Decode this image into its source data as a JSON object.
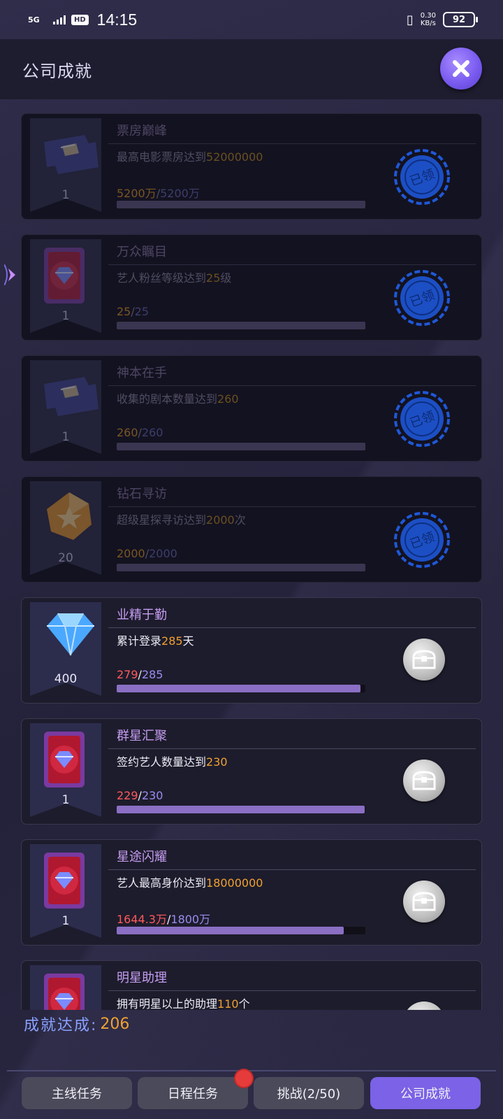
{
  "status_bar": {
    "network": "5G",
    "hd": "HD",
    "time": "14:15",
    "speed_value": "0.30",
    "speed_unit": "KB/s",
    "battery": "92"
  },
  "header": {
    "title": "公司成就"
  },
  "achievements": [
    {
      "title": "票房巅峰",
      "desc_prefix": "最高电影票房达到",
      "desc_value": "52000000",
      "desc_suffix": "",
      "progress_current": "5200万",
      "progress_target": "5200万",
      "progress_fraction": 1.0,
      "reward_count": "1",
      "reward_icon": "ticket-icon",
      "status": "claimed",
      "stamp_text": "已领"
    },
    {
      "title": "万众瞩目",
      "desc_prefix": "艺人粉丝等级达到",
      "desc_value": "25",
      "desc_suffix": "级",
      "progress_current": "25",
      "progress_target": "25",
      "progress_fraction": 1.0,
      "reward_count": "1",
      "reward_icon": "diamond-card-icon",
      "status": "claimed",
      "stamp_text": "已领"
    },
    {
      "title": "神本在手",
      "desc_prefix": "收集的剧本数量达到",
      "desc_value": "260",
      "desc_suffix": "",
      "progress_current": "260",
      "progress_target": "260",
      "progress_fraction": 1.0,
      "reward_count": "1",
      "reward_icon": "ticket-icon",
      "status": "claimed",
      "stamp_text": "已领"
    },
    {
      "title": "钻石寻访",
      "desc_prefix": "超级星探寻访达到",
      "desc_value": "2000",
      "desc_suffix": "次",
      "progress_current": "2000",
      "progress_target": "2000",
      "progress_fraction": 1.0,
      "reward_count": "20",
      "reward_icon": "star-gem-icon",
      "status": "claimed",
      "stamp_text": "已领"
    },
    {
      "title": "业精于勤",
      "desc_prefix": "累计登录",
      "desc_value": "285",
      "desc_suffix": "天",
      "progress_current": "279",
      "progress_target": "285",
      "progress_fraction": 0.979,
      "reward_count": "400",
      "reward_icon": "diamond-icon",
      "status": "in_progress"
    },
    {
      "title": "群星汇聚",
      "desc_prefix": "签约艺人数量达到",
      "desc_value": "230",
      "desc_suffix": "",
      "progress_current": "229",
      "progress_target": "230",
      "progress_fraction": 0.996,
      "reward_count": "1",
      "reward_icon": "diamond-card-icon",
      "status": "in_progress"
    },
    {
      "title": "星途闪耀",
      "desc_prefix": "艺人最高身价达到",
      "desc_value": "18000000",
      "desc_suffix": "",
      "progress_current": "1644.3万",
      "progress_target": "1800万",
      "progress_fraction": 0.914,
      "reward_count": "1",
      "reward_icon": "diamond-card-icon",
      "status": "in_progress"
    },
    {
      "title": "明星助理",
      "desc_prefix": "拥有明星以上的助理",
      "desc_value": "110",
      "desc_suffix": "个",
      "progress_current": "",
      "progress_target": "",
      "progress_fraction": 0.9,
      "reward_count": "",
      "reward_icon": "diamond-card-icon",
      "status": "in_progress"
    }
  ],
  "summary": {
    "label": "成就达成:",
    "value": "206"
  },
  "tabs": [
    {
      "label": "主线任务",
      "active": false,
      "badge": false
    },
    {
      "label": "日程任务",
      "active": false,
      "badge": true
    },
    {
      "label": "挑战(2/50)",
      "active": false,
      "badge": false
    },
    {
      "label": "公司成就",
      "active": true,
      "badge": false
    }
  ],
  "colors": {
    "accent": "#7b62e6",
    "highlight": "#f0a030",
    "progress_current": "#ff5a5a",
    "progress_target": "#9a8cf0",
    "title": "#c59cf0"
  }
}
